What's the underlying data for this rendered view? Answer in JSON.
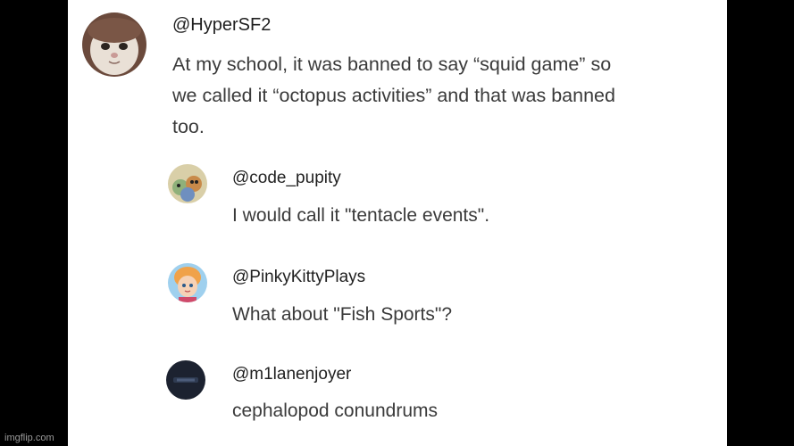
{
  "comments": [
    {
      "handle": "@HyperSF2",
      "lines": [
        "At my school, it was banned to say “squid game” so",
        "we called it “octopus activities” and that was banned",
        "too."
      ],
      "avatar_icon": "cat-face-avatar-icon"
    },
    {
      "handle": "@code_pupity",
      "lines": [
        "I would call it \"tentacle events\"."
      ],
      "avatar_icon": "cartoon-characters-avatar-icon"
    },
    {
      "handle": "@PinkyKittyPlays",
      "lines": [
        "What about \"Fish Sports\"?"
      ],
      "avatar_icon": "cartoon-girl-avatar-icon"
    },
    {
      "handle": "@m1lanenjoyer",
      "lines": [
        "cephalopod conundrums"
      ],
      "avatar_icon": "dark-logo-avatar-icon"
    }
  ],
  "watermark": "imgflip.com",
  "colors": {
    "background": "#000000",
    "panel": "#ffffff",
    "handle": "#1f1f1f",
    "text": "#3a3a3a"
  }
}
